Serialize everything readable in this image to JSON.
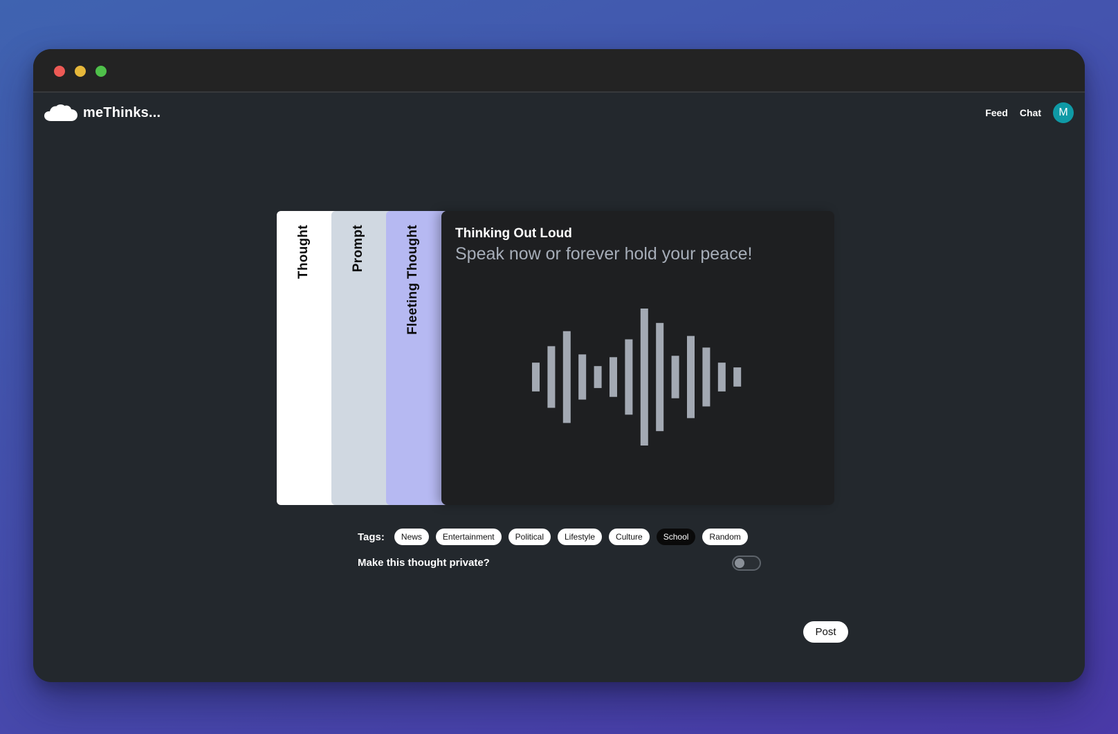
{
  "window": {
    "traffic_lights": [
      "close",
      "minimize",
      "zoom"
    ]
  },
  "header": {
    "brand": "meThinks...",
    "logo_icon": "cloud-icon",
    "nav": [
      {
        "label": "Feed"
      },
      {
        "label": "Chat"
      }
    ],
    "avatar_initial": "M",
    "avatar_color": "#0f9aa6"
  },
  "post_types": [
    {
      "label": "Thought",
      "color": "#ffffff"
    },
    {
      "label": "Prompt",
      "color": "#d0d8e1"
    },
    {
      "label": "Fleeting Thought",
      "color": "#b6b9f2"
    }
  ],
  "panel": {
    "title": "Thinking Out Loud",
    "subtitle": "Speak now or forever hold your peace!",
    "icon": "audio-waveform-icon",
    "waveform_levels": [
      0.21,
      0.45,
      0.67,
      0.33,
      0.16,
      0.29,
      0.55,
      1.0,
      0.79,
      0.31,
      0.6,
      0.43,
      0.21,
      0.14
    ]
  },
  "tags": {
    "label": "Tags:",
    "items": [
      "News",
      "Entertainment",
      "Political",
      "Lifestyle",
      "Culture",
      "School",
      "Random"
    ],
    "selected": "School"
  },
  "privacy": {
    "label": "Make this thought private?",
    "enabled": false
  },
  "actions": {
    "post_label": "Post"
  }
}
